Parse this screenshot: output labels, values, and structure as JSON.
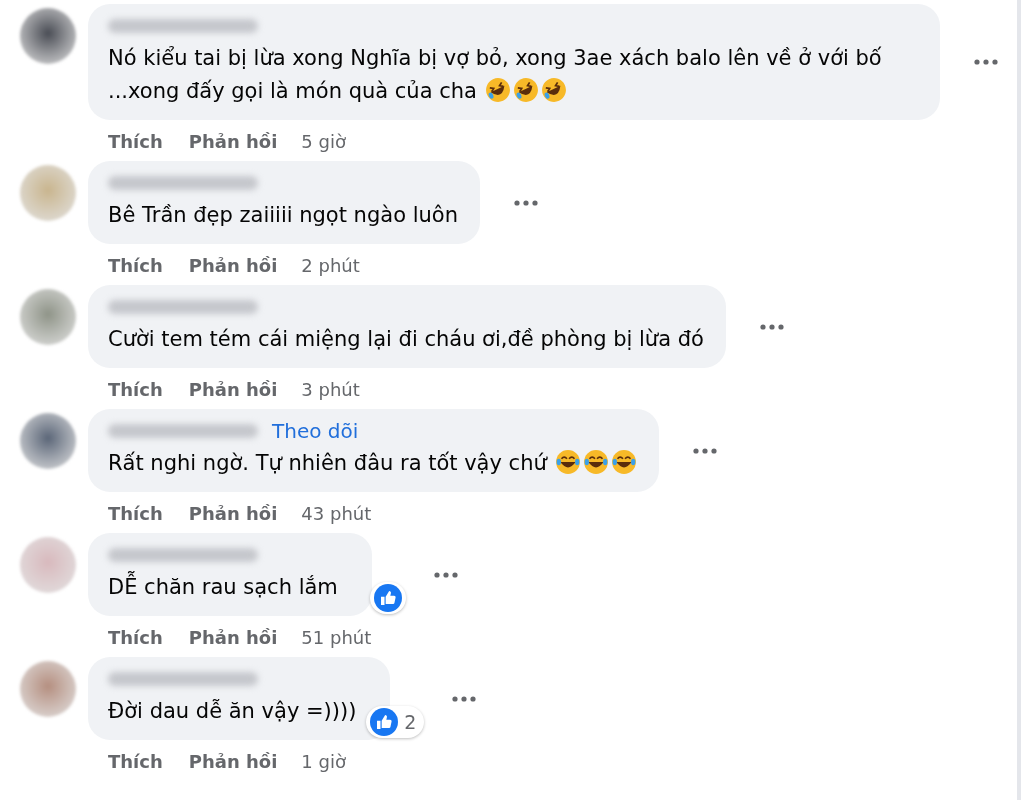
{
  "comments": [
    {
      "text": "Nó kiểu tai bị lừa xong Nghĩa bị vợ bỏ, xong 3ae xách balo lên về ở với bố ...xong đấy gọi là món quà của cha",
      "emojis": [
        {
          "kind": "rofl"
        },
        {
          "kind": "rofl"
        },
        {
          "kind": "rofl"
        }
      ],
      "like_label": "Thích",
      "reply_label": "Phản hồi",
      "time": "5 giờ"
    },
    {
      "text": "Bê Trần đẹp zaiiiii ngọt ngào luôn",
      "like_label": "Thích",
      "reply_label": "Phản hồi",
      "time": "2 phút"
    },
    {
      "text": "Cười tem tém cái miệng lại đi cháu ơi,đề phòng bị lừa đó",
      "like_label": "Thích",
      "reply_label": "Phản hồi",
      "time": "3 phút"
    },
    {
      "follow_link": "Theo dõi",
      "text": "Rất nghi ngờ. Tự nhiên đâu ra tốt vậy chứ",
      "emojis": [
        {
          "kind": "joy"
        },
        {
          "kind": "joy"
        },
        {
          "kind": "joy"
        }
      ],
      "like_label": "Thích",
      "reply_label": "Phản hồi",
      "time": "43 phút"
    },
    {
      "text": "DỄ chăn rau sạch lắm",
      "reaction": {
        "kind": "like"
      },
      "like_label": "Thích",
      "reply_label": "Phản hồi",
      "time": "51 phút"
    },
    {
      "text": "Đời dau dễ ăn vậy =))))",
      "reaction": {
        "kind": "like",
        "count": "2"
      },
      "like_label": "Thích",
      "reply_label": "Phản hồi",
      "time": "1 giờ"
    }
  ]
}
